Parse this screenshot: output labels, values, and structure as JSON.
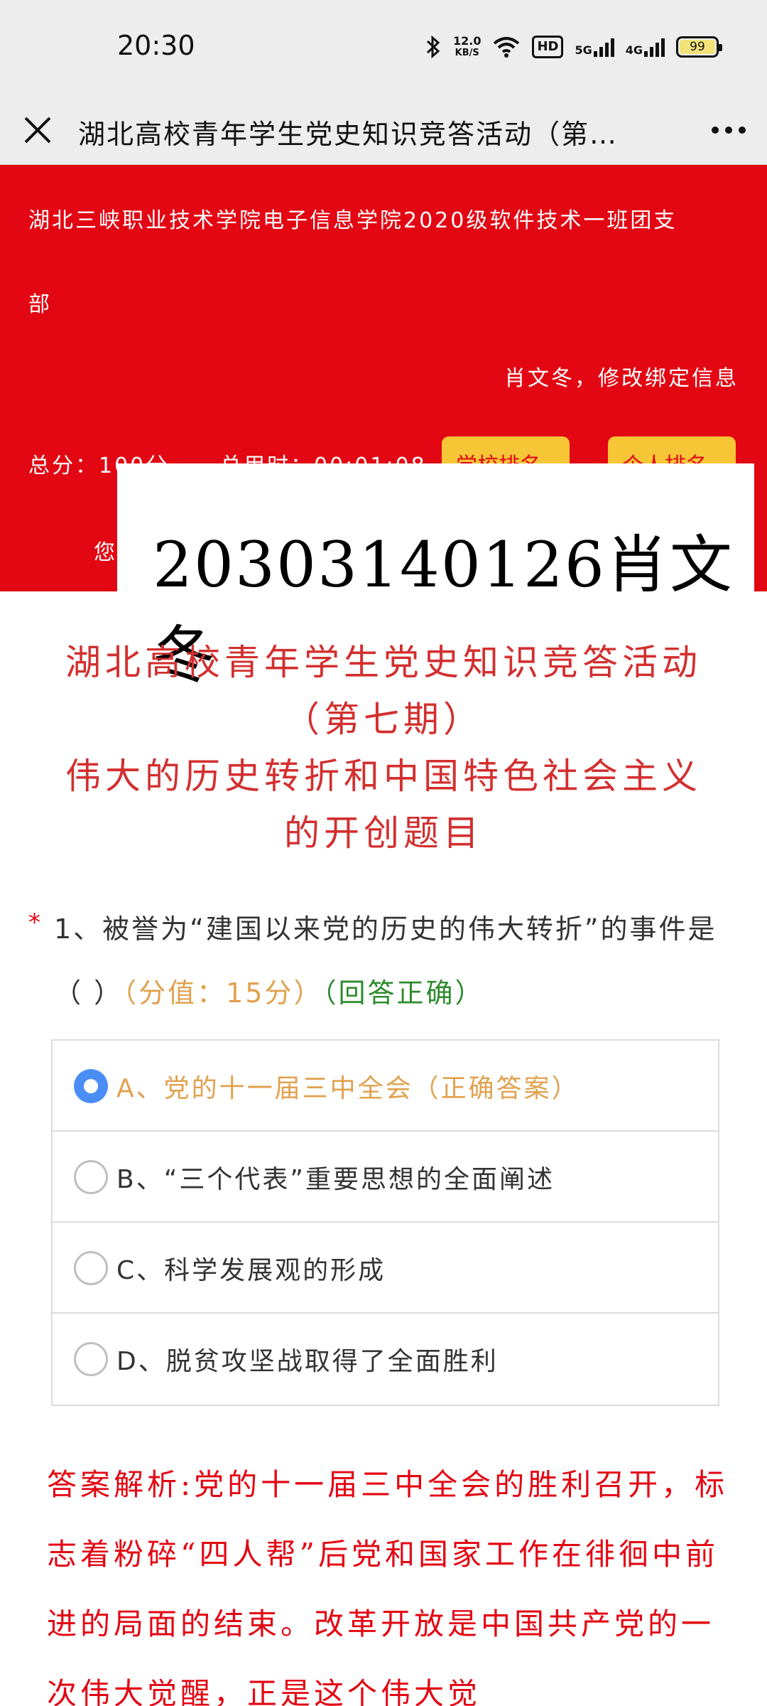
{
  "status_bar": {
    "time": "20:30",
    "network_speed_value": "12.0",
    "network_speed_unit": "KB/S",
    "hd_label": "HD",
    "signal1_label": "5G",
    "signal2_label": "4G",
    "battery": "99",
    "icons": [
      "bluetooth-icon",
      "wifi-icon",
      "signal-icon",
      "battery-icon"
    ]
  },
  "nav": {
    "title": "湖北高校青年学生党史知识竞答活动（第…"
  },
  "banner": {
    "org_line1": "湖北三峡职业技术学院电子信息学院2020级软件技术一班团支",
    "org_line2": "部",
    "user_bind": "肖文冬，修改绑定信息",
    "total_score": "总分：100分",
    "time_used": "总用时：00:01:08",
    "school_rank": "学校排名",
    "personal_rank": "个人排名",
    "you_prefix": "您",
    "overlay_text": "20303140126肖文冬",
    "colors": {
      "background": "#e30613",
      "button": "#f6c637"
    }
  },
  "main": {
    "title_line1": "湖北高校青年学生党史知识竞答活动",
    "title_line2": "（第七期）",
    "title_line3": "伟大的历史转折和中国特色社会主义",
    "title_line4": "的开创题目"
  },
  "question": {
    "required_mark": "*",
    "text": "1、被誉为“建国以来党的历史的伟大转折”的事件是（ ）",
    "score": "（分值：15分）",
    "status": "（回答正确）",
    "options": [
      {
        "label": "A、党的十一届三中全会（正确答案）",
        "selected": true
      },
      {
        "label": "B、“三个代表”重要思想的全面阐述",
        "selected": false
      },
      {
        "label": "C、科学发展观的形成",
        "selected": false
      },
      {
        "label": "D、脱贫攻坚战取得了全面胜利",
        "selected": false
      }
    ]
  },
  "analysis": {
    "text": "答案解析:党的十一届三中全会的胜利召开，标志着粉碎“四人帮”后党和国家工作在徘徊中前进的局面的结束。改革开放是中国共产党的一次伟大觉醒，正是这个伟大觉"
  }
}
